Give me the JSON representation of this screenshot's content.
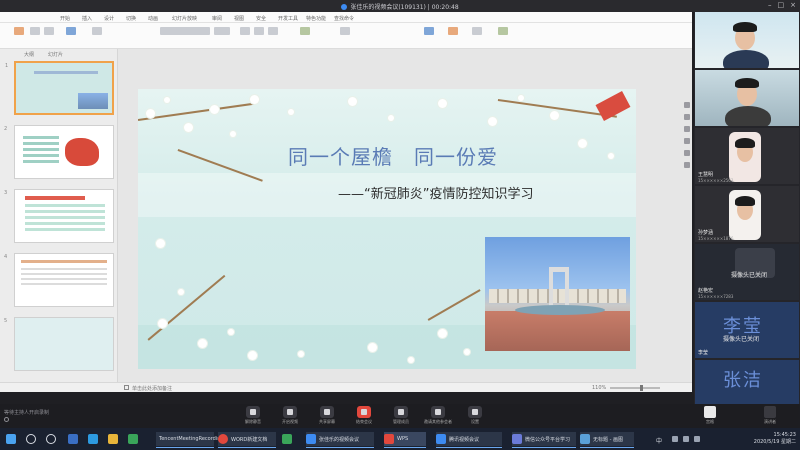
{
  "meeting": {
    "title": "张佳乐的视频会议(109131) | 00:20:48",
    "window_controls": [
      "–",
      "□",
      "×"
    ]
  },
  "wps": {
    "menu_tabs": [
      "开始",
      "插入",
      "设计",
      "切换",
      "动画",
      "幻灯片放映",
      "审阅",
      "视图",
      "安全",
      "开发工具",
      "特色功能",
      "查找命令"
    ],
    "thumb_tabs": [
      "大纲",
      "幻灯片"
    ],
    "slide_numbers": [
      "1",
      "2",
      "3",
      "4",
      "5"
    ],
    "status_note": "单击此处添加备注",
    "zoom": "110%"
  },
  "slide": {
    "title": "同一个屋檐　同一份爱",
    "subtitle": "——“新冠肺炎”疫情防控知识学习"
  },
  "participants": [
    {
      "name": ""
    },
    {
      "name": ""
    },
    {
      "name": "王慧明",
      "sub": "15××××××2563"
    },
    {
      "name": "孙梦涵",
      "sub": "15××××××1876"
    },
    {
      "name": "赵艳宏",
      "sub": "15××××××7283",
      "watermark": "摄像头已关闭"
    },
    {
      "name": "李莹",
      "big": "李莹",
      "watermark": "摄像头已关闭"
    },
    {
      "name": "",
      "big": "张洁"
    }
  ],
  "toolbar": {
    "recording": "等待主持人开启录制",
    "buttons": [
      "解除静音",
      "开启视频",
      "共享屏幕",
      "结束会议",
      "管理成员",
      "邀请其他参会者",
      "设置"
    ],
    "right_buttons": [
      "宫格",
      "演讲者"
    ]
  },
  "taskbar": {
    "apps": [
      {
        "label": "TencentMeetingRecording"
      },
      {
        "label": "WORD新建文档"
      },
      {
        "label": ""
      },
      {
        "label": "张佳乐的视频会议"
      },
      {
        "label": "WPS"
      },
      {
        "label": "腾讯视频会议"
      },
      {
        "label": "微信公众号平台学习"
      },
      {
        "label": "无标题 - 画图"
      }
    ],
    "time": "15:45:23",
    "date": "2020/5/19 星期二",
    "lang": "中"
  },
  "colors": {
    "slide_title": "#5a7bb5",
    "end_button": "#e2483d",
    "selected_thumb": "#f0a24a"
  }
}
